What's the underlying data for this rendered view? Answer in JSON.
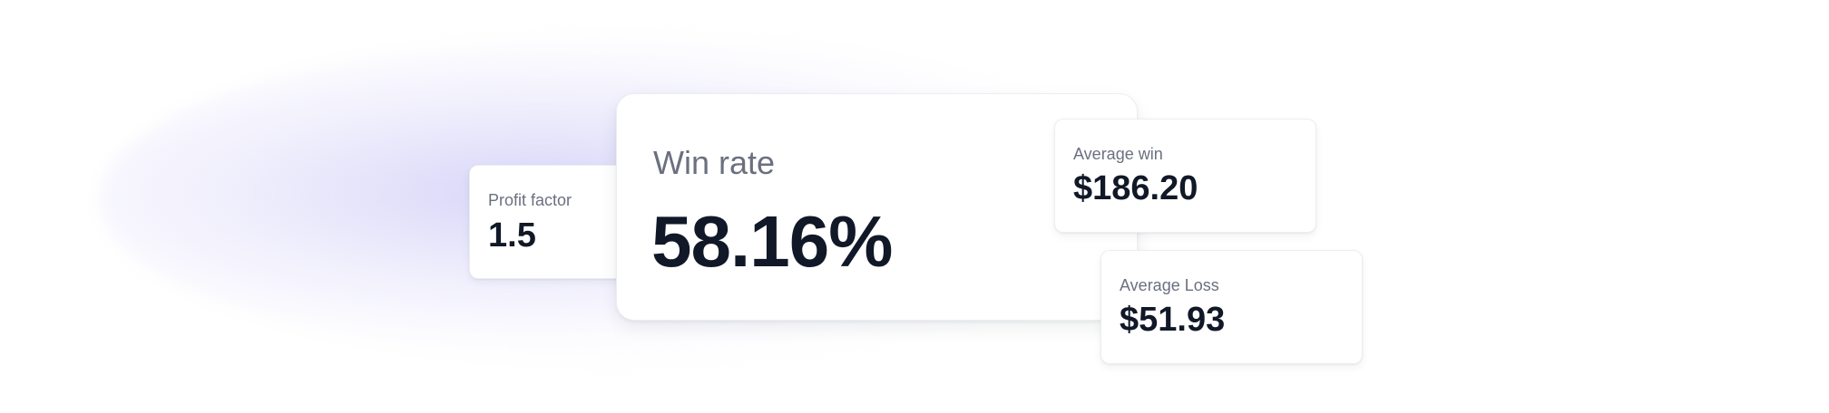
{
  "cards": {
    "profit_factor": {
      "label": "Profit factor",
      "value": "1.5"
    },
    "win_rate": {
      "label": "Win rate",
      "value": "58.16%"
    },
    "average_win": {
      "label": "Average win",
      "value": "$186.20"
    },
    "average_loss": {
      "label": "Average Loss",
      "value": "$51.93"
    }
  },
  "colors": {
    "label": "#6b7080",
    "value": "#111827",
    "glow": "#c6c4f5"
  }
}
